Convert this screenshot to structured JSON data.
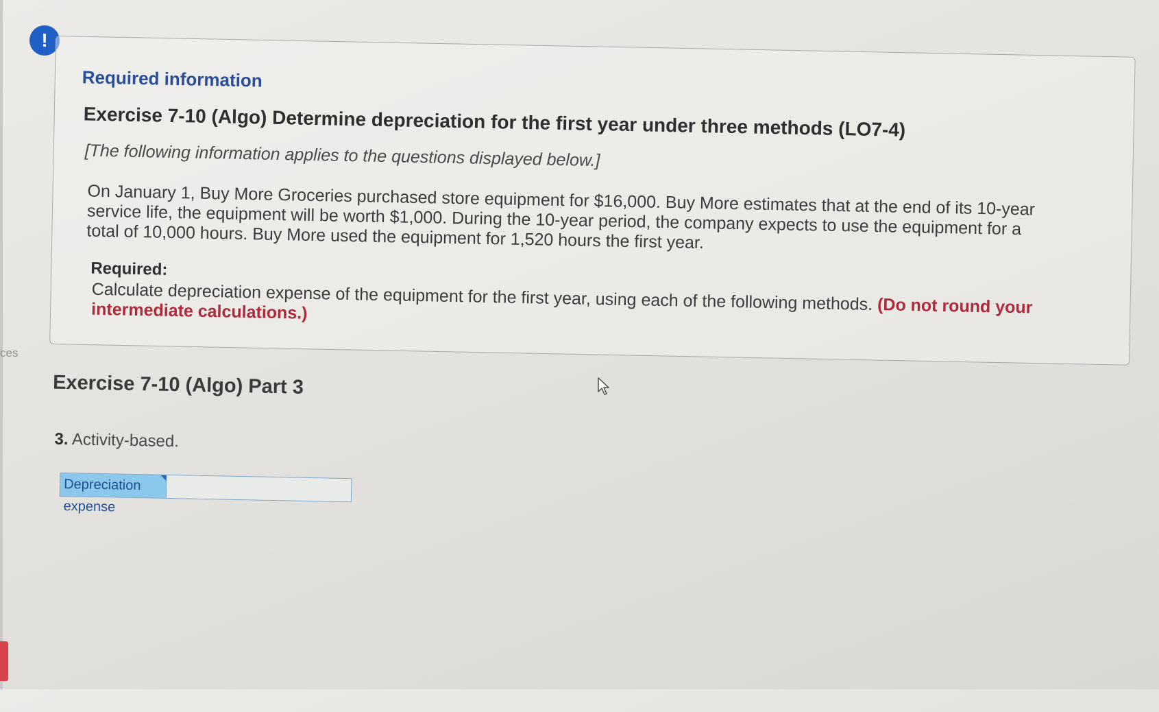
{
  "sidebar": {
    "partial_label": "ces"
  },
  "alert_icon": {
    "symbol": "!",
    "color": "#1f5fc6"
  },
  "info_box": {
    "heading": "Required information",
    "exercise_title": "Exercise 7-10 (Algo) Determine depreciation for the first year under three methods (LO7-4)",
    "applies_note": "[The following information applies to the questions displayed below.]",
    "scenario": "On January 1, Buy More Groceries purchased store equipment for $16,000. Buy More estimates that at the end of its 10-year service life, the equipment will be worth $1,000. During the 10-year period, the company expects to use the equipment for a total of 10,000 hours. Buy More used the equipment for 1,520 hours the first year.",
    "required_label": "Required:",
    "required_text": "Calculate depreciation expense of the equipment for the first year, using each of the following methods.",
    "round_note": "(Do not round your intermediate calculations.)"
  },
  "part": {
    "title": "Exercise 7-10 (Algo) Part 3",
    "question_number": "3.",
    "question_text": "Activity-based."
  },
  "answer": {
    "label": "Depreciation expense",
    "value": ""
  },
  "colors": {
    "heading_blue": "#2a4e9a",
    "round_note_red": "#b02b3a",
    "answer_label_bg": "#8cc7ec"
  }
}
